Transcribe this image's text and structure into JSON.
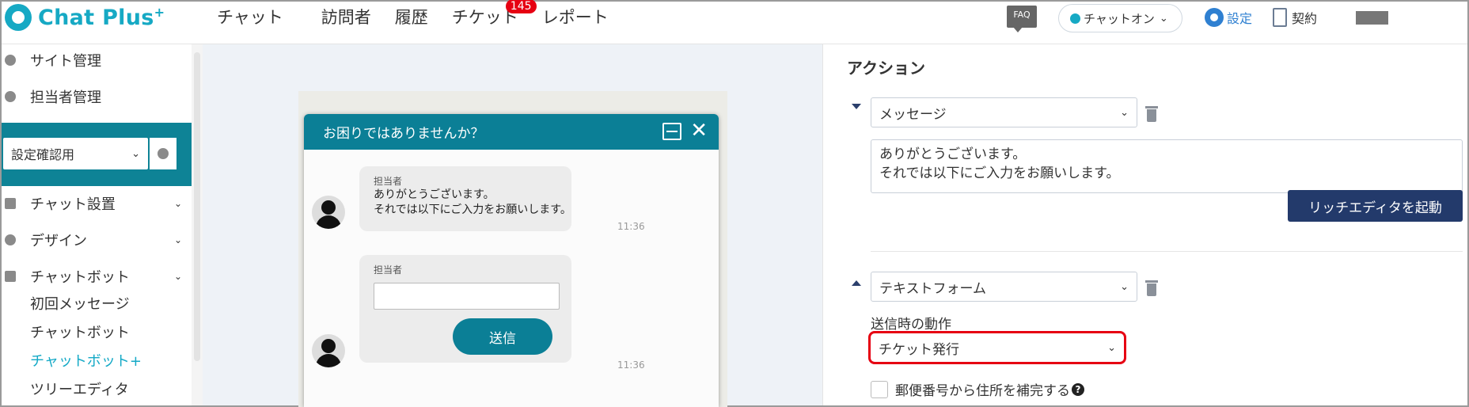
{
  "header": {
    "logo_text": "Chat Plus",
    "logo_sup": "+",
    "nav": [
      {
        "label": "チャット"
      },
      {
        "label": "訪問者"
      },
      {
        "label": "履歴"
      },
      {
        "label": "チケット",
        "badge": "145"
      },
      {
        "label": "レポート"
      }
    ],
    "faq_label": "FAQ",
    "status_label": "チャットオン",
    "settings_label": "設定",
    "contract_label": "契約",
    "icons": {
      "status": "status-dot-icon",
      "settings": "gear-icon",
      "contract": "document-icon"
    }
  },
  "sidebar": {
    "top_items": [
      {
        "label": "サイト管理",
        "icon": "gear-icon"
      },
      {
        "label": "担当者管理",
        "icon": "users-icon"
      }
    ],
    "site_select": {
      "value": "設定確認用"
    },
    "sections": [
      {
        "label": "チャット設置",
        "icon": "tools-icon"
      },
      {
        "label": "デザイン",
        "icon": "palette-icon"
      },
      {
        "label": "チャットボット",
        "icon": "chat-icon"
      }
    ],
    "sub_items": [
      {
        "label": "初回メッセージ",
        "active": false
      },
      {
        "label": "チャットボット",
        "active": false
      },
      {
        "label": "チャットボット+",
        "active": true
      },
      {
        "label": "ツリーエディタ",
        "active": false
      }
    ]
  },
  "widget": {
    "title": "お困りではありませんか？",
    "messages": [
      {
        "sender": "担当者",
        "text_line1": "ありがとうございます。",
        "text_line2": "それでは以下にご入力をお願いします。",
        "time": "11:36"
      },
      {
        "sender": "担当者",
        "send_label": "送信",
        "time": "11:36"
      }
    ]
  },
  "right_panel": {
    "title": "アクション",
    "action1": {
      "type_value": "メッセージ",
      "text_line1": "ありがとうございます。",
      "text_line2": "それでは以下にご入力をお願いします。",
      "rich_editor_label": "リッチエディタを起動"
    },
    "action2": {
      "type_value": "テキストフォーム",
      "send_behavior_label": "送信時の動作",
      "send_behavior_value": "チケット発行",
      "postal_label": "郵便番号から住所を補完する",
      "postal_checked": false,
      "help_glyph": "?"
    }
  },
  "colors": {
    "brand": "#16a9c4",
    "widget_header": "#0b7f96",
    "sidebar_teal": "#0e8396",
    "primary_button": "#233a6b",
    "highlight": "#e60012",
    "active_link": "#14a9c6"
  }
}
